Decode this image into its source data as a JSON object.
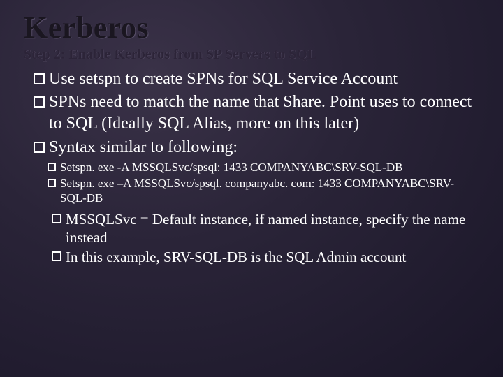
{
  "title": "Kerberos",
  "subtitle": "Step 2: Enable Kerberos from SP Servers to SQL",
  "lv1": [
    "Use setspn to create SPNs for SQL Service Account",
    "SPNs need to match the name that Share. Point uses to connect to SQL (Ideally SQL Alias, more on this later)",
    "Syntax similar to following:"
  ],
  "lv3": [
    "Setspn. exe  -A MSSQLSvc/spsql: 1433 COMPANYABC\\SRV-SQL-DB",
    "Setspn. exe –A MSSQLSvc/spsql. companyabc. com: 1433 COMPANYABC\\SRV-SQL-DB"
  ],
  "lv2": [
    "MSSQLSvc = Default instance, if named instance, specify the name instead",
    "In this example, SRV-SQL-DB is the SQL Admin account"
  ]
}
